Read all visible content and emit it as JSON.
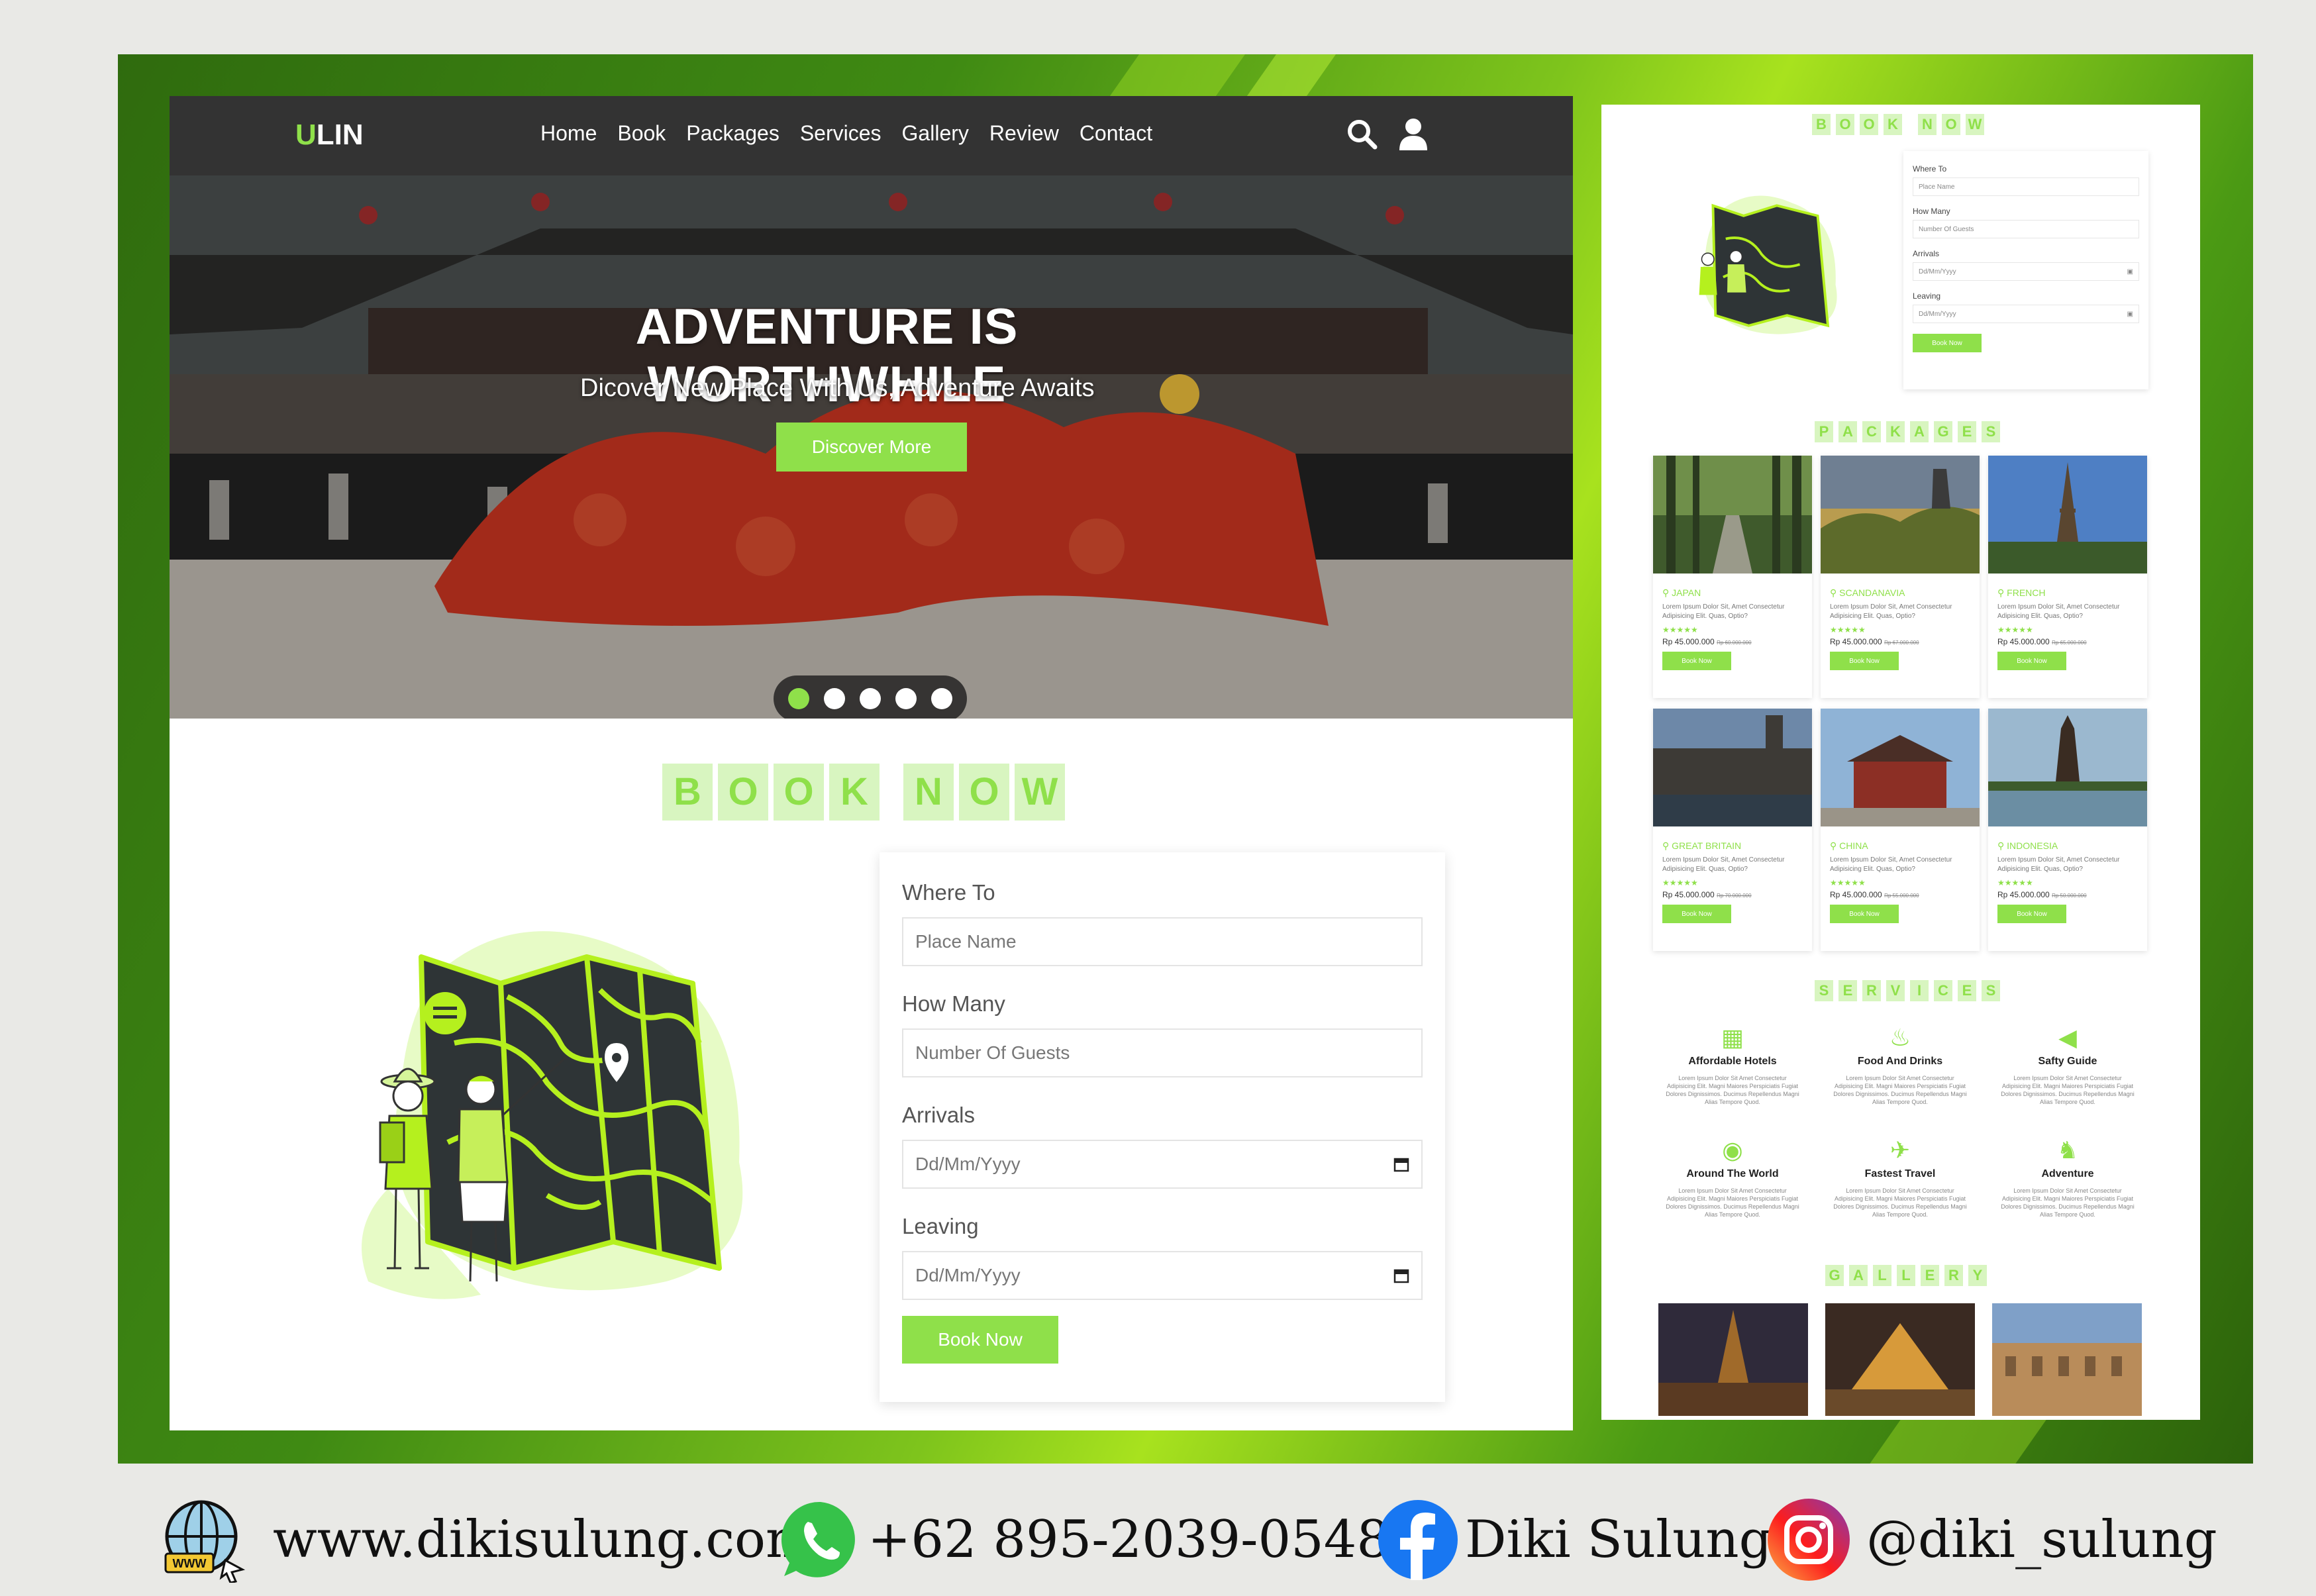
{
  "nav": {
    "logo_first": "U",
    "logo_rest": "LIN",
    "items": [
      "Home",
      "Book",
      "Packages",
      "Services",
      "Gallery",
      "Review",
      "Contact"
    ],
    "search_icon": "search-icon",
    "user_icon": "user-icon"
  },
  "hero": {
    "title": "ADVENTURE IS WORTHWHILE",
    "subtitle": "Dicover New Place With Us, Adventure Awaits",
    "cta": "Discover More",
    "slide_count": 5,
    "active_slide": 1
  },
  "book": {
    "title_letters": [
      "B",
      "O",
      "O",
      "K",
      "",
      "N",
      "O",
      "W"
    ],
    "where_label": "Where To",
    "where_placeholder": "Place Name",
    "many_label": "How Many",
    "many_placeholder": "Number Of Guests",
    "arrivals_label": "Arrivals",
    "arrivals_value": "Dd/Mm/Yyyy",
    "leaving_label": "Leaving",
    "leaving_value": "Dd/Mm/Yyyy",
    "submit": "Book Now"
  },
  "side": {
    "book_title_letters": [
      "B",
      "O",
      "O",
      "K",
      "",
      "N",
      "O",
      "W"
    ],
    "packages_title_letters": [
      "P",
      "A",
      "C",
      "K",
      "A",
      "G",
      "E",
      "S"
    ],
    "services_title_letters": [
      "S",
      "E",
      "R",
      "V",
      "I",
      "C",
      "E",
      "S"
    ],
    "gallery_title_letters": [
      "G",
      "A",
      "L",
      "L",
      "E",
      "R",
      "Y"
    ],
    "packages": [
      {
        "loc": "JAPAN",
        "desc": "Lorem Ipsum Dolor Sit, Amet Consectetur Adipisicing Elit. Quas, Optio?",
        "stars": "★★★★★",
        "price": "Rp 45.000.000",
        "old": "Rp 60.000.000",
        "btn": "Book Now"
      },
      {
        "loc": "SCANDANAVIA",
        "desc": "Lorem Ipsum Dolor Sit, Amet Consectetur Adipisicing Elit. Quas, Optio?",
        "stars": "★★★★★",
        "price": "Rp 45.000.000",
        "old": "Rp 67.000.000",
        "btn": "Book Now"
      },
      {
        "loc": "FRENCH",
        "desc": "Lorem Ipsum Dolor Sit, Amet Consectetur Adipisicing Elit. Quas, Optio?",
        "stars": "★★★★★",
        "price": "Rp 45.000.000",
        "old": "Rp 65.000.000",
        "btn": "Book Now"
      },
      {
        "loc": "GREAT BRITAIN",
        "desc": "Lorem Ipsum Dolor Sit, Amet Consectetur Adipisicing Elit. Quas, Optio?",
        "stars": "★★★★★",
        "price": "Rp 45.000.000",
        "old": "Rp 70.000.000",
        "btn": "Book Now"
      },
      {
        "loc": "CHINA",
        "desc": "Lorem Ipsum Dolor Sit, Amet Consectetur Adipisicing Elit. Quas, Optio?",
        "stars": "★★★★★",
        "price": "Rp 45.000.000",
        "old": "Rp 55.000.000",
        "btn": "Book Now"
      },
      {
        "loc": "INDONESIA",
        "desc": "Lorem Ipsum Dolor Sit, Amet Consectetur Adipisicing Elit. Quas, Optio?",
        "stars": "★★★★★",
        "price": "Rp 45.000.000",
        "old": "Rp 50.000.000",
        "btn": "Book Now"
      }
    ],
    "services": [
      {
        "icon": "hotel-icon",
        "title": "Affordable Hotels",
        "desc": "Lorem Ipsum Dolor Sit Amet Consectetur Adipisicing Elit. Magni Maiores Perspiciatis Fugiat Dolores Dignissimos. Ducimus Repellendus Magni Alias Tempore Quod."
      },
      {
        "icon": "food-icon",
        "title": "Food And Drinks",
        "desc": "Lorem Ipsum Dolor Sit Amet Consectetur Adipisicing Elit. Magni Maiores Perspiciatis Fugiat Dolores Dignissimos. Ducimus Repellendus Magni Alias Tempore Quod."
      },
      {
        "icon": "megaphone-icon",
        "title": "Safty Guide",
        "desc": "Lorem Ipsum Dolor Sit Amet Consectetur Adipisicing Elit. Magni Maiores Perspiciatis Fugiat Dolores Dignissimos. Ducimus Repellendus Magni Alias Tempore Quod."
      },
      {
        "icon": "globe-icon",
        "title": "Around The World",
        "desc": "Lorem Ipsum Dolor Sit Amet Consectetur Adipisicing Elit. Magni Maiores Perspiciatis Fugiat Dolores Dignissimos. Ducimus Repellendus Magni Alias Tempore Quod."
      },
      {
        "icon": "plane-icon",
        "title": "Fastest Travel",
        "desc": "Lorem Ipsum Dolor Sit Amet Consectetur Adipisicing Elit. Magni Maiores Perspiciatis Fugiat Dolores Dignissimos. Ducimus Repellendus Magni Alias Tempore Quod."
      },
      {
        "icon": "hiking-icon",
        "title": "Adventure",
        "desc": "Lorem Ipsum Dolor Sit Amet Consectetur Adipisicing Elit. Magni Maiores Perspiciatis Fugiat Dolores Dignissimos. Ducimus Repellendus Magni Alias Tempore Quod."
      }
    ]
  },
  "footer": {
    "website": "www.dikisulung.com",
    "phone": "+62 895-2039-0548",
    "facebook": "Diki Sulung",
    "instagram": "@diki_sulung"
  },
  "colors": {
    "accent": "#8fe04a",
    "nav": "#333333",
    "frame": "#3f8a13"
  }
}
